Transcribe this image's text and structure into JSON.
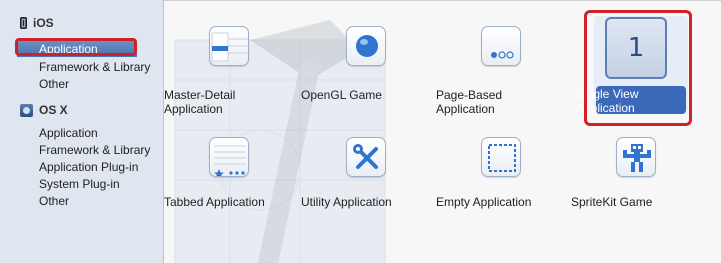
{
  "sidebar": {
    "ios": {
      "title": "iOS",
      "items": [
        "Application",
        "Framework & Library",
        "Other"
      ]
    },
    "osx": {
      "title": "OS X",
      "items": [
        "Application",
        "Framework & Library",
        "Application Plug-in",
        "System Plug-in",
        "Other"
      ]
    },
    "selected_item": "Application"
  },
  "templates": {
    "master_detail": {
      "label1": "Master-Detail",
      "label2": "Application",
      "icon": "master-detail-icon"
    },
    "opengl": {
      "label1": "OpenGL Game",
      "icon": "opengl-game-icon"
    },
    "page_based": {
      "label1": "Page-Based",
      "label2": "Application",
      "icon": "page-based-icon"
    },
    "single_view": {
      "label1": "Single View",
      "label2": "Application",
      "icon_text": "1",
      "selected": true,
      "icon": "single-view-icon"
    },
    "tabbed": {
      "label1": "Tabbed Application",
      "icon": "tabbed-icon"
    },
    "utility": {
      "label1": "Utility Application",
      "icon": "utility-icon"
    },
    "empty": {
      "label1": "Empty Application",
      "icon": "empty-icon"
    },
    "spritekit": {
      "label1": "SpriteKit Game",
      "icon": "spritekit-icon"
    }
  },
  "colors": {
    "selection": "#3c68b9",
    "highlight_box": "#d0202a",
    "icon_blue": "#2f74d0"
  }
}
